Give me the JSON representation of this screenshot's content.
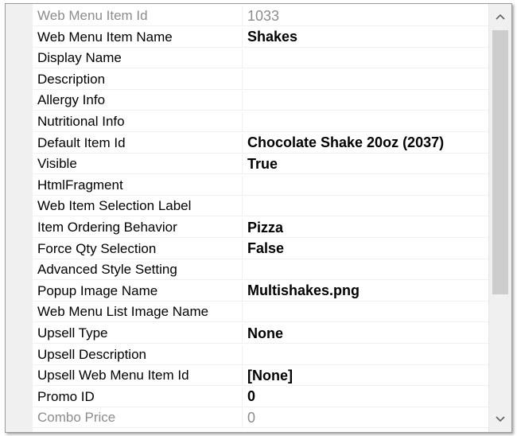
{
  "properties": [
    {
      "name": "Web Menu Item Id",
      "value": "1033",
      "disabled": true
    },
    {
      "name": "Web Menu Item Name",
      "value": "Shakes"
    },
    {
      "name": "Display Name",
      "value": ""
    },
    {
      "name": "Description",
      "value": ""
    },
    {
      "name": "Allergy Info",
      "value": ""
    },
    {
      "name": "Nutritional Info",
      "value": ""
    },
    {
      "name": "Default Item Id",
      "value": "Chocolate Shake 20oz (2037)"
    },
    {
      "name": "Visible",
      "value": "True"
    },
    {
      "name": "HtmlFragment",
      "value": ""
    },
    {
      "name": "Web Item Selection Label",
      "value": ""
    },
    {
      "name": "Item Ordering Behavior",
      "value": "Pizza"
    },
    {
      "name": "Force Qty Selection",
      "value": "False"
    },
    {
      "name": "Advanced Style Setting",
      "value": ""
    },
    {
      "name": "Popup Image Name",
      "value": "Multishakes.png"
    },
    {
      "name": "Web Menu List Image Name",
      "value": ""
    },
    {
      "name": "Upsell Type",
      "value": "None"
    },
    {
      "name": "Upsell Description",
      "value": ""
    },
    {
      "name": "Upsell Web Menu Item Id",
      "value": "[None]"
    },
    {
      "name": "Promo ID",
      "value": "0"
    },
    {
      "name": "Combo Price",
      "value": "0",
      "disabled": true
    }
  ],
  "scrollbar": {
    "up_icon": "chevron-up-icon",
    "down_icon": "chevron-down-icon"
  },
  "colors": {
    "grid_line": "#f0f0f0",
    "disabled_text": "#8c8c8c",
    "thumb": "#cdcdcd"
  }
}
